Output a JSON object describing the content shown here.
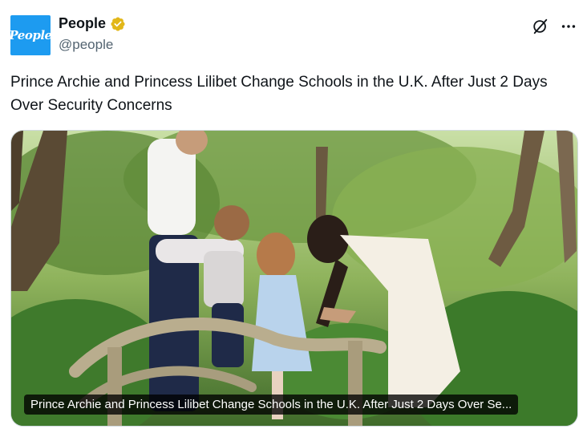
{
  "account": {
    "avatar_text": "People",
    "display_name": "People",
    "handle": "@people",
    "verified": true,
    "avatar_color": "#1d9bf0",
    "verified_color": "#e2b719"
  },
  "icons": {
    "grok": "grok-icon",
    "more": "more-icon",
    "verified": "verified-badge-icon"
  },
  "tweet": {
    "text": "Prince Archie and Princess Lilibet Change Schools in the U.K. After Just 2 Days Over Security Concerns"
  },
  "media": {
    "caption": "Prince Archie and Princess Lilibet Change Schools in the U.K. After Just 2 Days Over Se..."
  }
}
